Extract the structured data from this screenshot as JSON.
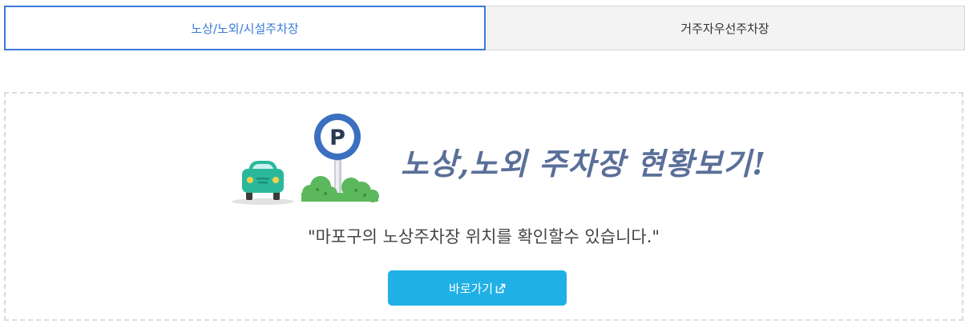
{
  "tabs": [
    {
      "label": "노상/노외/시설주차장",
      "active": true
    },
    {
      "label": "거주자우선주차장",
      "active": false
    }
  ],
  "panel": {
    "headline": "노상,노외 주차장 현황보기!",
    "subtext": "\"마포구의 노상주차장 위치를 확인할수 있습니다.\"",
    "button_label": "바로가기",
    "button_icon": "external-link-icon",
    "sign_letter": "P"
  },
  "colors": {
    "active_tab": "#3b7ad8",
    "button": "#1fb0e6",
    "headline": "#5a6f98",
    "car": "#2bb89a",
    "bush": "#5cb85c",
    "sign": "#3b6fbf"
  }
}
